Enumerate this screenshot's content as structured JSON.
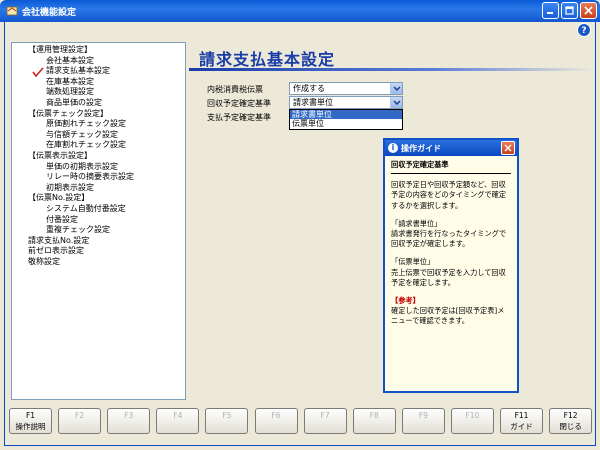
{
  "window": {
    "title": "会社機能設定"
  },
  "tree": {
    "items": [
      {
        "label": "【運用管理設定】",
        "level": "lv0"
      },
      {
        "label": "会社基本設定",
        "level": "lv1"
      },
      {
        "label": "請求支払基本設定",
        "level": "lv1",
        "selected": true
      },
      {
        "label": "在庫基本設定",
        "level": "lv1"
      },
      {
        "label": "端数処理設定",
        "level": "lv1"
      },
      {
        "label": "商品単価の設定",
        "level": "lv1"
      },
      {
        "label": "【伝票チェック設定】",
        "level": "lv0"
      },
      {
        "label": "原価割れチェック設定",
        "level": "lv1"
      },
      {
        "label": "与信額チェック設定",
        "level": "lv1"
      },
      {
        "label": "在庫割れチェック設定",
        "level": "lv1"
      },
      {
        "label": "【伝票表示設定】",
        "level": "lv0"
      },
      {
        "label": "単価の初期表示設定",
        "level": "lv1"
      },
      {
        "label": "リレー時の摘要表示設定",
        "level": "lv1"
      },
      {
        "label": "初期表示設定",
        "level": "lv1"
      },
      {
        "label": "【伝票No.設定】",
        "level": "lv0"
      },
      {
        "label": "システム自動付番設定",
        "level": "lv1"
      },
      {
        "label": "付番設定",
        "level": "lv1"
      },
      {
        "label": "重複チェック設定",
        "level": "lv1"
      },
      {
        "label": "請求支払No.設定",
        "level": "root"
      },
      {
        "label": "前ゼロ表示設定",
        "level": "root"
      },
      {
        "label": "敬称設定",
        "level": "root"
      }
    ]
  },
  "content": {
    "title": "請求支払基本設定",
    "fields": [
      {
        "label": "内税消費税伝票",
        "value": "作成する"
      },
      {
        "label": "回収予定確定基準",
        "value": "請求書単位"
      },
      {
        "label": "支払予定確定基準",
        "value": ""
      }
    ],
    "dropdown": {
      "options": [
        "請求書単位",
        "伝票単位"
      ],
      "selected_index": 0
    }
  },
  "guide": {
    "title": "操作ガイド",
    "heading": "回収予定確定基準",
    "paragraphs": [
      "回収予定日や回収予定額など、回収予定の内容をどのタイミングで確定するかを選択します。",
      "「請求書単位」\n請求書発行を行なったタイミングで回収予定が確定します。",
      "「伝票単位」\n売上伝票で回収予定を入力して回収予定を確定します。"
    ],
    "ref_label": "【参考】",
    "ref_text": "確定した回収予定は[回収予定表]メニューで確認できます。"
  },
  "fkeys": [
    {
      "key": "F1",
      "label": "操作説明",
      "enabled": true
    },
    {
      "key": "F2",
      "label": "",
      "enabled": false
    },
    {
      "key": "F3",
      "label": "",
      "enabled": false
    },
    {
      "key": "F4",
      "label": "",
      "enabled": false
    },
    {
      "key": "F5",
      "label": "",
      "enabled": false
    },
    {
      "key": "F6",
      "label": "",
      "enabled": false
    },
    {
      "key": "F7",
      "label": "",
      "enabled": false
    },
    {
      "key": "F8",
      "label": "",
      "enabled": false
    },
    {
      "key": "F9",
      "label": "",
      "enabled": false
    },
    {
      "key": "F10",
      "label": "",
      "enabled": false
    },
    {
      "key": "F11",
      "label": "ガイド",
      "enabled": true
    },
    {
      "key": "F12",
      "label": "閉じる",
      "enabled": true
    }
  ],
  "colors": {
    "titlebar": "#0a5ad6",
    "heading": "#1a3ca8",
    "selection": "#316ac5",
    "reference": "#c00000"
  }
}
